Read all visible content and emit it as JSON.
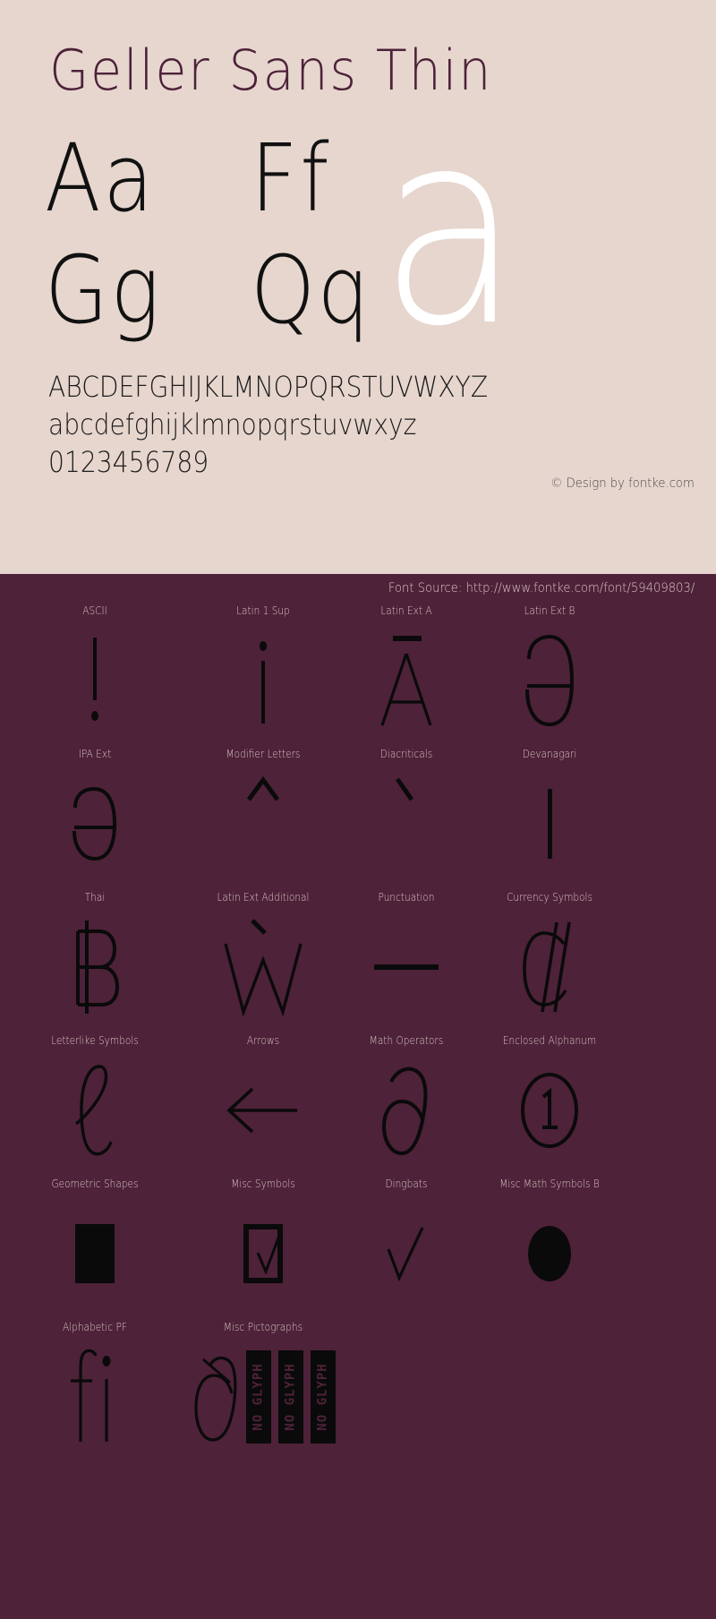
{
  "theme": {
    "light_bg": "#e6d6ce",
    "dark_bg": "#4e2239",
    "title_color": "#4d2239",
    "glyph_color": "#0a0a0a",
    "hero_color": "#ffffff",
    "label_color": "#d6c2c0"
  },
  "specimen": {
    "title": "Geller Sans Thin",
    "letter_pairs": [
      "Aa",
      "Ff",
      "Gg",
      "Qq"
    ],
    "hero_glyph": "a",
    "uppercase": "ABCDEFGHIJKLMNOPQRSTUVWXYZ",
    "lowercase": "abcdefghijklmnopqrstuvwxyz",
    "digits": "0123456789",
    "copyright": "© Design by fontke.com"
  },
  "source_bar": {
    "text": "Font Source: http://www.fontke.com/font/59409803/"
  },
  "blocks": [
    {
      "label": "ASCII",
      "sample": "!",
      "icon": "exclamation-glyph"
    },
    {
      "label": "Latin 1 Sup",
      "sample": "¡",
      "icon": "inverted-exclamation-glyph"
    },
    {
      "label": "Latin Ext A",
      "sample": "Ā",
      "icon": "a-macron-glyph"
    },
    {
      "label": "Latin Ext B",
      "sample": "Ə",
      "icon": "schwa-capital-glyph"
    },
    {
      "label": "IPA Ext",
      "sample": "ə",
      "icon": "schwa-glyph"
    },
    {
      "label": "Modifier Letters",
      "sample": "ˆ",
      "icon": "circumflex-modifier-glyph"
    },
    {
      "label": "Diacriticals",
      "sample": "`",
      "icon": "grave-accent-glyph"
    },
    {
      "label": "Devanagari",
      "sample": "।",
      "icon": "danda-glyph"
    },
    {
      "label": "Thai",
      "sample": "฿",
      "icon": "baht-glyph"
    },
    {
      "label": "Latin Ext Additional",
      "sample": "Ẁ",
      "icon": "w-grave-glyph"
    },
    {
      "label": "Punctuation",
      "sample": "—",
      "icon": "em-dash-glyph"
    },
    {
      "label": "Currency Symbols",
      "sample": "₡",
      "icon": "colon-currency-glyph"
    },
    {
      "label": "Letterlike Symbols",
      "sample": "ℓ",
      "icon": "script-l-glyph"
    },
    {
      "label": "Arrows",
      "sample": "←",
      "icon": "left-arrow-glyph"
    },
    {
      "label": "Math Operators",
      "sample": "∂",
      "icon": "partial-derivative-glyph"
    },
    {
      "label": "Enclosed Alphanum",
      "sample": "①",
      "icon": "circled-one-glyph"
    },
    {
      "label": "Geometric Shapes",
      "sample": "■",
      "icon": "filled-square-glyph"
    },
    {
      "label": "Misc Symbols",
      "sample": "☑",
      "icon": "checked-box-glyph"
    },
    {
      "label": "Dingbats",
      "sample": "✓",
      "icon": "check-mark-glyph"
    },
    {
      "label": "Misc Math Symbols B",
      "sample": "●",
      "icon": "filled-circle-glyph"
    },
    {
      "label": "Alphabetic PF",
      "sample": "ﬁ",
      "icon": "fi-ligature-glyph"
    },
    {
      "label": "Misc Pictographs",
      "sample": "",
      "icon": "no-glyph-boxes"
    }
  ],
  "no_glyph_label": "NO GLYPH",
  "no_glyph_count": 3
}
